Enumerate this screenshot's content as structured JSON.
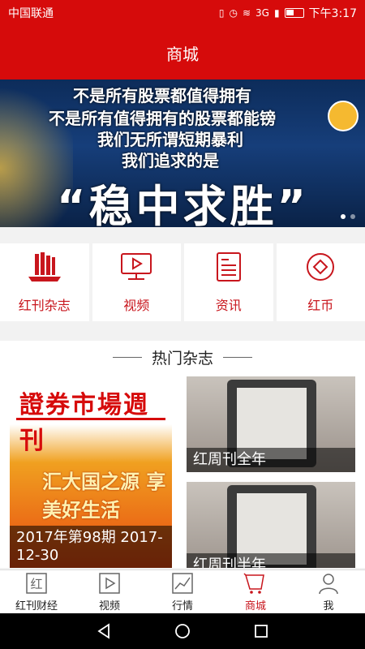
{
  "status": {
    "carrier": "中国联通",
    "network": "3G",
    "time": "下午3:17"
  },
  "header": {
    "title": "商城"
  },
  "banner": {
    "lines": [
      "不是所有股票都值得拥有",
      "不是所有值得拥有的股票都能镑",
      "我们无所谓短期暴利",
      "我们追求的是"
    ],
    "headline": "“稳中求胜”"
  },
  "quick_nav": [
    {
      "label": "红刊杂志",
      "icon": "magazines-icon"
    },
    {
      "label": "视频",
      "icon": "video-icon"
    },
    {
      "label": "资讯",
      "icon": "news-icon"
    },
    {
      "label": "红币",
      "icon": "coin-icon"
    }
  ],
  "section": {
    "title": "热门杂志"
  },
  "magazines": [
    {
      "cover_title": "證券市場週刊",
      "cover_issue": "98",
      "cover_headline": "汇大国之源 享美好生活",
      "caption": "2017年第98期 2017-12-30"
    },
    {
      "caption": "红周刊全年"
    },
    {
      "caption": "红周刊半年"
    }
  ],
  "tabs": [
    {
      "label": "红刊财经",
      "icon": "hongkan-icon"
    },
    {
      "label": "视频",
      "icon": "video-play-icon"
    },
    {
      "label": "行情",
      "icon": "chart-icon"
    },
    {
      "label": "商城",
      "icon": "cart-icon",
      "active": true
    },
    {
      "label": "我",
      "icon": "user-icon"
    }
  ],
  "colors": {
    "brand_red": "#d60b0b",
    "accent_red": "#c8161d"
  }
}
